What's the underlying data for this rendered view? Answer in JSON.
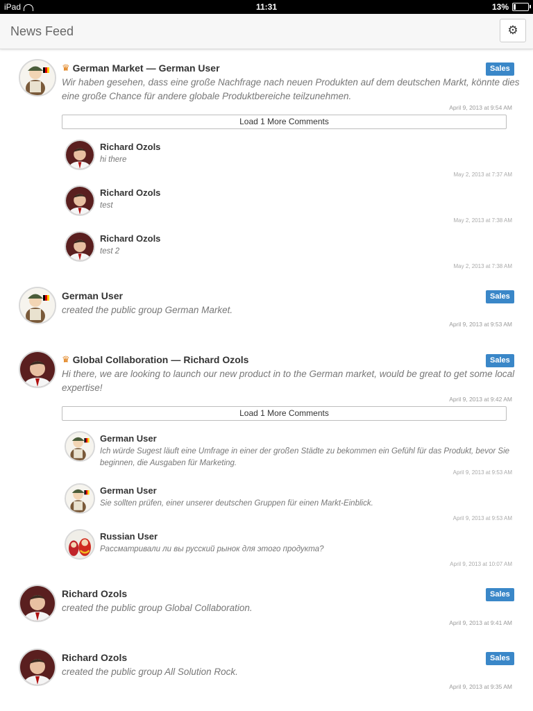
{
  "statusbar": {
    "device": "iPad",
    "time": "11:31",
    "battery": "13%",
    "battery_level": 0.13
  },
  "header": {
    "title": "News Feed",
    "settings_icon": "⚙"
  },
  "posts": [
    {
      "group": "German Market",
      "sep": "—",
      "author": "German User",
      "badge": "Sales",
      "body": "Wir haben gesehen, dass eine große Nachfrage nach neuen Produkten auf dem deutschen Markt, könnte dies eine große Chance für andere globale Produktbereiche teilzunehmen.",
      "time": "April 9, 2013 at 9:54 AM",
      "load_more": "Load 1 More Comments",
      "comments": [
        {
          "author": "Richard Ozols",
          "text": "hi there",
          "time": "May 2, 2013 at 7:37 AM"
        },
        {
          "author": "Richard Ozols",
          "text": "test",
          "time": "May 2, 2013 at 7:38 AM"
        },
        {
          "author": "Richard Ozols",
          "text": "test 2",
          "time": "May 2, 2013 at 7:38 AM"
        }
      ]
    },
    {
      "author": "German User",
      "badge": "Sales",
      "body": "created the public group German Market.",
      "time": "April 9, 2013 at 9:53 AM"
    },
    {
      "group": "Global Collaboration",
      "sep": "—",
      "author": "Richard Ozols",
      "badge": "Sales",
      "body": "Hi there, we are looking to launch our new product in to the German market, would be great to get some local expertise!",
      "time": "April 9, 2013 at 9:42 AM",
      "load_more": "Load 1 More Comments",
      "comments": [
        {
          "author": "German User",
          "text": "Ich würde Sugest läuft eine Umfrage in einer der großen Städte zu bekommen ein Gefühl für das Produkt, bevor Sie beginnen, die Ausgaben für Marketing.",
          "time": "April 9, 2013 at 9:53 AM"
        },
        {
          "author": "German User",
          "text": "Sie sollten prüfen, einer unserer deutschen Gruppen für einen Markt-Einblick.",
          "time": "April 9, 2013 at 9:53 AM"
        },
        {
          "author": "Russian User",
          "text": "Рассматривали ли вы русский рынок для этого продукта?",
          "time": "April 9, 2013 at 10:07 AM"
        }
      ]
    },
    {
      "author": "Richard Ozols",
      "badge": "Sales",
      "body": "created the public group Global Collaboration.",
      "time": "April 9, 2013 at 9:41 AM"
    },
    {
      "author": "Richard Ozols",
      "badge": "Sales",
      "body": "created the public group All Solution Rock.",
      "time": "April 9, 2013 at 9:35 AM"
    }
  ],
  "colors": {
    "badge": "#3a87c8",
    "crown": "#e07b10"
  },
  "icons": {
    "group": "crown-icon",
    "settings": "gear-icon"
  }
}
